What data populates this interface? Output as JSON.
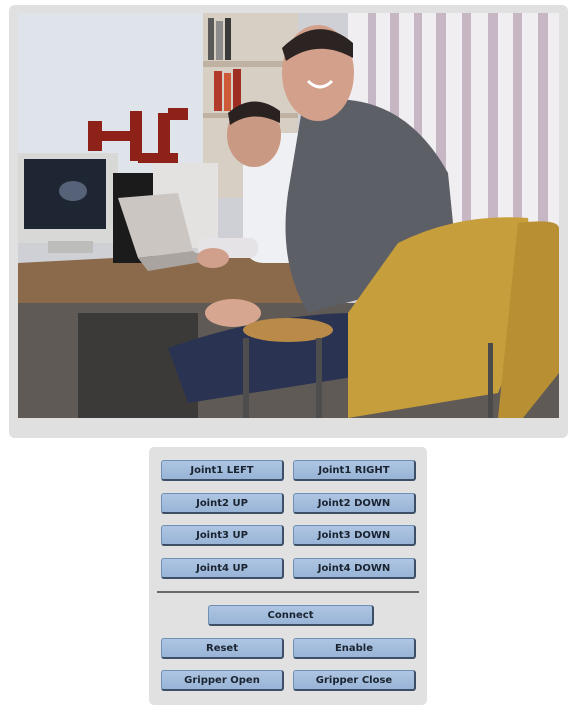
{
  "camera": {
    "label": "camera-feed"
  },
  "controls": {
    "joint_buttons": [
      {
        "left": "Joint1 LEFT",
        "right": "Joint1 RIGHT"
      },
      {
        "left": "Joint2 UP",
        "right": "Joint2 DOWN"
      },
      {
        "left": "Joint3 UP",
        "right": "Joint3 DOWN"
      },
      {
        "left": "Joint4 UP",
        "right": "Joint4 DOWN"
      }
    ],
    "connect_label": "Connect",
    "reset_label": "Reset",
    "enable_label": "Enable",
    "gripper_open_label": "Gripper Open",
    "gripper_close_label": "Gripper Close"
  },
  "colors": {
    "button_fill": "#a9c2e0",
    "button_border": "#3c4f66",
    "panel_bg": "#e0e0e0"
  }
}
